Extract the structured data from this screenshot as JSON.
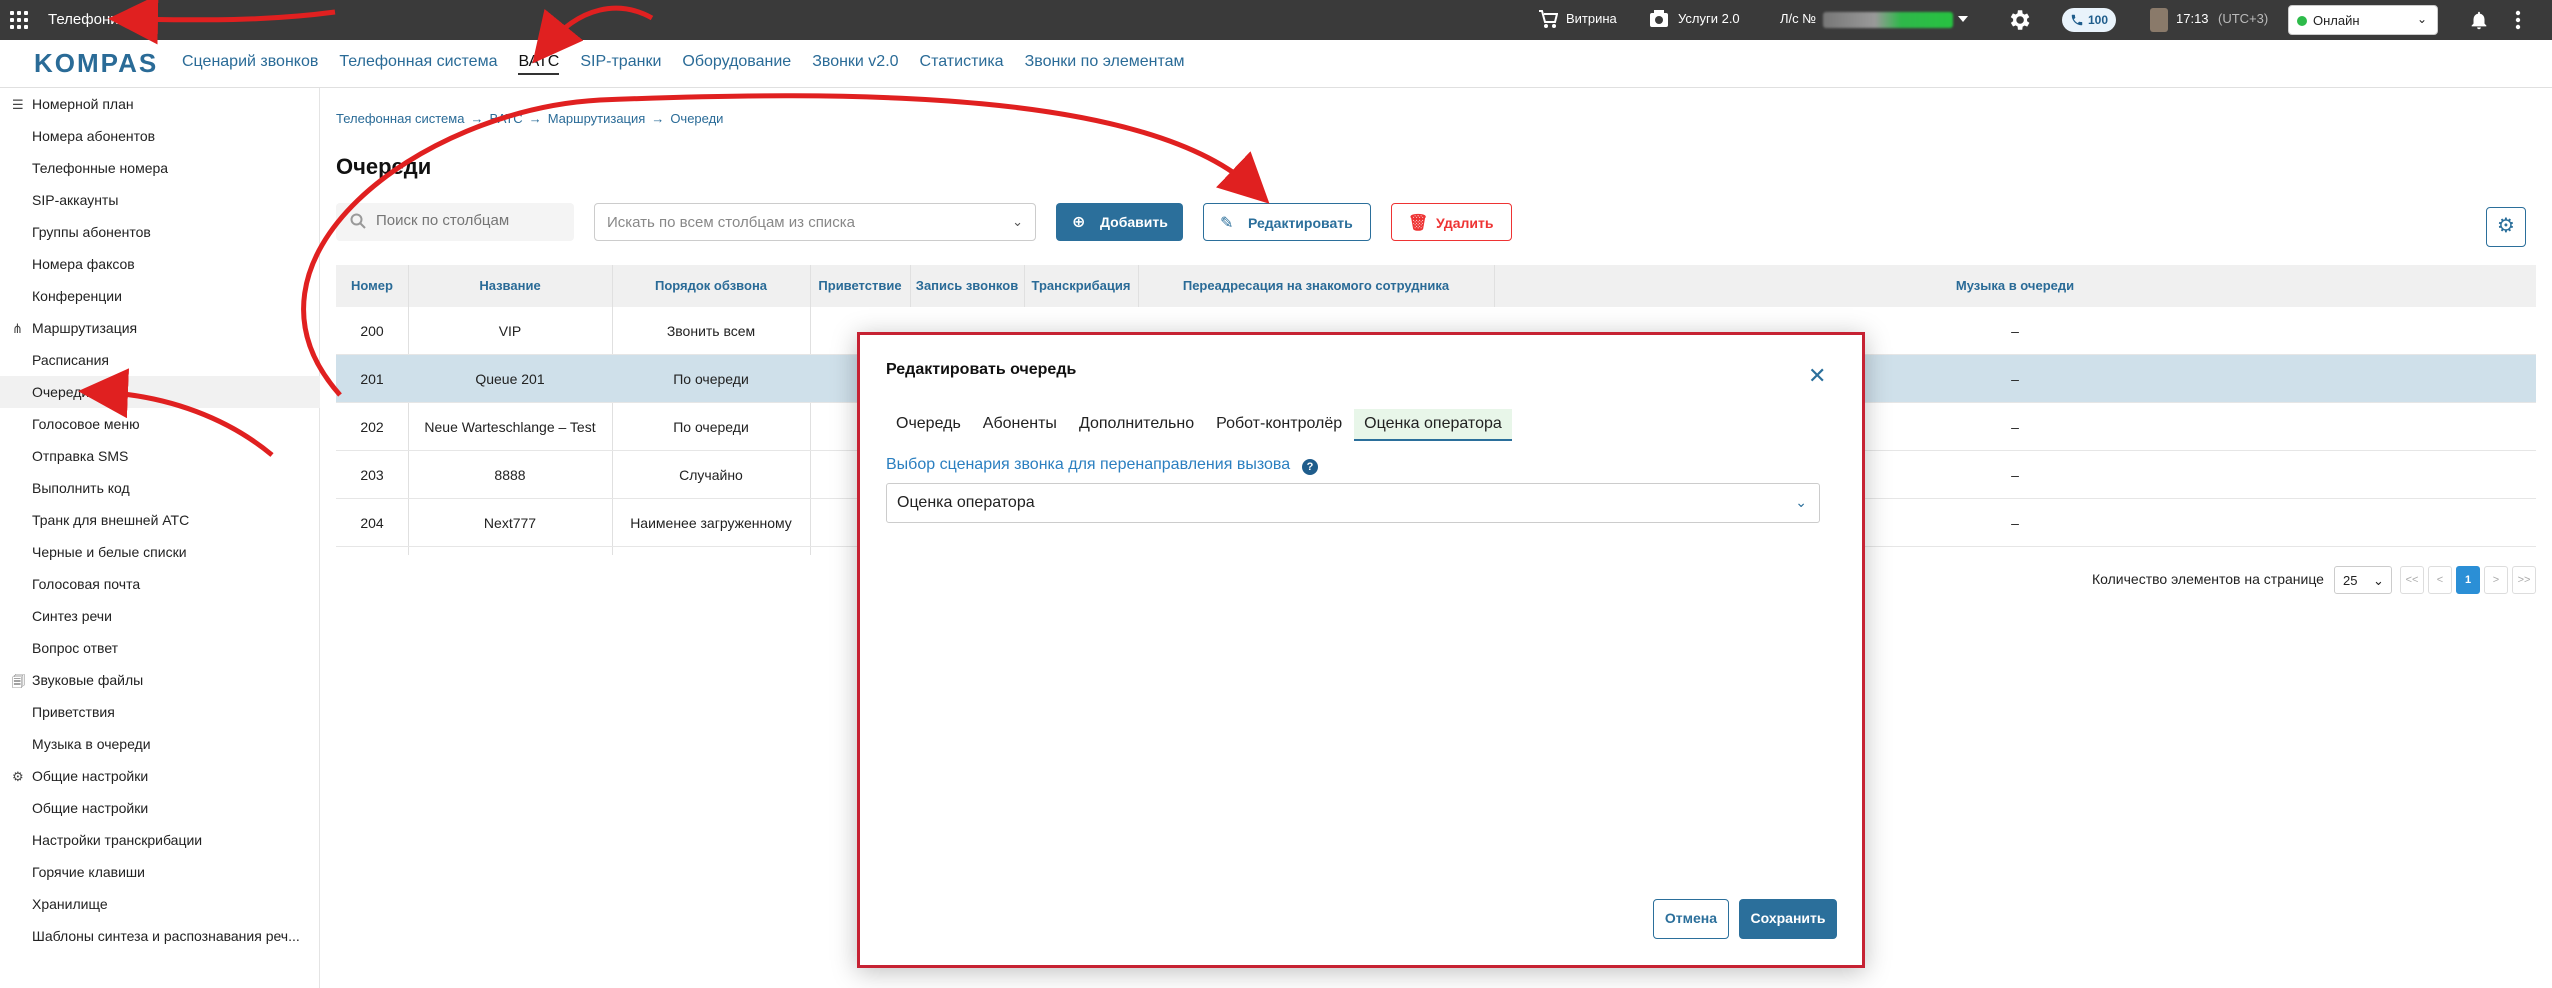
{
  "topbar": {
    "app_title": "Телефония",
    "showcase": "Витрина",
    "services": "Услуги 2.0",
    "account_label": "Л/с №",
    "calls_count": "100",
    "time": "17:13",
    "timezone": "(UTC+3)",
    "status": "Онлайн"
  },
  "brand": {
    "logo": "KOMPAS"
  },
  "nav": {
    "items": [
      "Сценарий звонков",
      "Телефонная система",
      "ВАТС",
      "SIP-транки",
      "Оборудование",
      "Звонки v2.0",
      "Статистика",
      "Звонки по элементам"
    ],
    "active": "ВАТС"
  },
  "sidebar": {
    "items": [
      {
        "label": "Номерной план",
        "group": true
      },
      {
        "label": "Номера абонентов"
      },
      {
        "label": "Телефонные номера"
      },
      {
        "label": "SIP-аккаунты"
      },
      {
        "label": "Группы абонентов"
      },
      {
        "label": "Номера факсов"
      },
      {
        "label": "Конференции"
      },
      {
        "label": "Маршрутизация",
        "group": true
      },
      {
        "label": "Расписания"
      },
      {
        "label": "Очереди",
        "active": true
      },
      {
        "label": "Голосовое меню"
      },
      {
        "label": "Отправка SMS"
      },
      {
        "label": "Выполнить код"
      },
      {
        "label": "Транк для внешней АТС"
      },
      {
        "label": "Черные и белые списки"
      },
      {
        "label": "Голосовая почта"
      },
      {
        "label": "Синтез речи"
      },
      {
        "label": "Вопрос ответ"
      },
      {
        "label": "Звуковые файлы",
        "group": true
      },
      {
        "label": "Приветствия"
      },
      {
        "label": "Музыка в очереди"
      },
      {
        "label": "Общие настройки",
        "group": true
      },
      {
        "label": "Общие настройки"
      },
      {
        "label": "Настройки транскрибации"
      },
      {
        "label": "Горячие клавиши"
      },
      {
        "label": "Хранилище"
      },
      {
        "label": "Шаблоны синтеза и распознавания реч..."
      }
    ]
  },
  "breadcrumbs": [
    "Телефонная система",
    "ВАТС",
    "Маршрутизация",
    "Очереди"
  ],
  "page": {
    "title": "Очереди",
    "search_placeholder": "Поиск по столбцам",
    "columns_placeholder": "Искать по всем столбцам из списка",
    "add_label": "Добавить",
    "edit_label": "Редактировать",
    "delete_label": "Удалить"
  },
  "table": {
    "headers": [
      "Номер",
      "Название",
      "Порядок обзвона",
      "Приветствие",
      "Запись звонков",
      "Транскрибация",
      "Переадресация на знакомого сотрудника",
      "Музыка в очереди"
    ],
    "rows": [
      {
        "num": "200",
        "name": "VIP",
        "order": "Звонить всем",
        "music": "–"
      },
      {
        "num": "201",
        "name": "Queue 201",
        "order": "По очереди",
        "music": "–"
      },
      {
        "num": "202",
        "name": "Neue Warteschlange – Test",
        "order": "По очереди",
        "music": "–"
      },
      {
        "num": "203",
        "name": "8888",
        "order": "Случайно",
        "music": "–"
      },
      {
        "num": "204",
        "name": "Next777",
        "order": "Наименее загруженному",
        "music": "–"
      }
    ]
  },
  "pager": {
    "label": "Количество элементов на странице",
    "per_page": "25",
    "first": "<<",
    "prev": "<",
    "current": "1",
    "next": ">",
    "last": ">>"
  },
  "modal": {
    "title": "Редактировать очередь",
    "tabs": [
      "Очередь",
      "Абоненты",
      "Дополнительно",
      "Робот-контролёр",
      "Оценка оператора"
    ],
    "active_tab": "Оценка оператора",
    "field_label": "Выбор сценария звонка для перенаправления вызова",
    "field_value": "Оценка оператора",
    "cancel": "Отмена",
    "save": "Сохранить"
  },
  "colors": {
    "accent": "#2b6f9b",
    "danger": "#e33333",
    "annotation": "#e02020",
    "topbar": "#3a3a3a"
  }
}
